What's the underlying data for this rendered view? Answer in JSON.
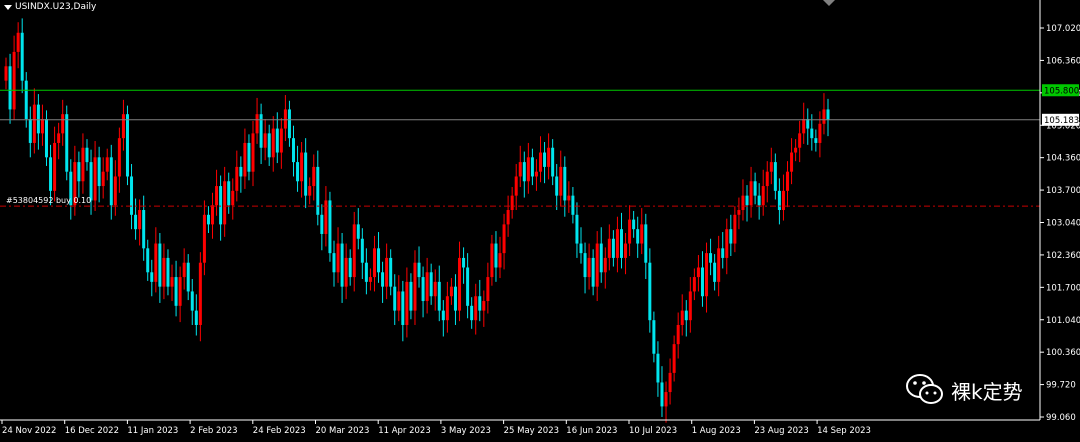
{
  "window": {
    "title": "USINDX.U23,Daily"
  },
  "order_label": "#53804592 buy 0.10",
  "watermark": {
    "text": "裸k定势",
    "icon": "wechat-icon"
  },
  "colors": {
    "background": "#000000",
    "bull": "#ff0000",
    "bear": "#00e5ee",
    "green_line": "#00c800",
    "price_line": "#808080",
    "order_line": "#c80000",
    "axis": "#ffffff",
    "green_tag": "#00c800"
  },
  "price_axis": {
    "ticks": [
      "107.020",
      "106.360",
      "105.680",
      "105.020",
      "104.360",
      "103.700",
      "103.040",
      "102.360",
      "101.700",
      "101.040",
      "100.360",
      "99.720",
      "99.060"
    ],
    "level_tags": {
      "green_level": "105.800",
      "current_price": "105.183"
    }
  },
  "time_axis": {
    "labels": [
      "24 Nov 2022",
      "16 Dec 2022",
      "11 Jan 2023",
      "2 Feb 2023",
      "24 Feb 2023",
      "20 Mar 2023",
      "11 Apr 2023",
      "3 May 2023",
      "25 May 2023",
      "16 Jun 2023",
      "10 Jul 2023",
      "1 Aug 2023",
      "23 Aug 2023",
      "14 Sep 2023"
    ]
  },
  "chart_data": {
    "type": "candlestick",
    "symbol": "USINDX.U23",
    "timeframe": "Daily",
    "ylim": [
      99.0,
      107.35
    ],
    "horizontal_levels": [
      {
        "label": "105.800",
        "price": 105.8
      },
      {
        "label": "105.183",
        "price": 105.183
      },
      {
        "label": "#53804592 buy 0.10",
        "price": 103.38
      }
    ],
    "closes": [
      106.3,
      105.4,
      106.6,
      107.0,
      106.0,
      105.2,
      104.7,
      105.5,
      104.9,
      105.2,
      104.4,
      103.7,
      104.7,
      104.9,
      105.3,
      104.1,
      103.4,
      104.3,
      103.9,
      104.6,
      104.3,
      103.5,
      104.4,
      103.8,
      104.1,
      104.4,
      103.4,
      104.0,
      104.8,
      105.3,
      104.0,
      103.2,
      102.9,
      103.3,
      102.5,
      102.0,
      101.8,
      102.6,
      101.7,
      102.3,
      101.7,
      101.9,
      101.3,
      101.9,
      102.2,
      101.6,
      101.2,
      100.9,
      102.2,
      103.2,
      103.0,
      103.4,
      103.8,
      103.0,
      103.9,
      103.4,
      103.7,
      104.2,
      104.0,
      104.7,
      104.1,
      104.9,
      105.3,
      104.6,
      104.9,
      104.4,
      105.0,
      104.5,
      105.0,
      105.4,
      104.8,
      104.3,
      103.9,
      104.5,
      103.6,
      103.8,
      104.2,
      103.2,
      102.8,
      103.5,
      102.4,
      102.0,
      102.6,
      101.7,
      102.3,
      101.9,
      103.0,
      102.7,
      102.2,
      101.8,
      101.9,
      102.5,
      102.0,
      101.7,
      102.3,
      101.7,
      101.2,
      101.6,
      100.9,
      101.8,
      101.2,
      102.2,
      101.9,
      101.4,
      102.0,
      101.5,
      101.8,
      101.2,
      101.0,
      101.5,
      101.7,
      101.2,
      102.3,
      102.1,
      101.3,
      101.0,
      101.5,
      101.2,
      101.4,
      101.9,
      102.6,
      102.1,
      102.4,
      103.0,
      103.3,
      103.6,
      104.0,
      104.3,
      103.9,
      104.4,
      104.0,
      104.1,
      104.5,
      104.2,
      104.6,
      104.0,
      103.6,
      104.2,
      103.5,
      103.6,
      103.2,
      102.6,
      102.4,
      101.9,
      102.3,
      101.7,
      102.6,
      102.0,
      102.3,
      102.7,
      102.3,
      102.9,
      102.3,
      102.6,
      103.1,
      102.9,
      102.6,
      103.0,
      102.2,
      101.0,
      100.3,
      99.7,
      99.2,
      99.5,
      99.9,
      100.5,
      100.9,
      101.2,
      101.0,
      101.6,
      101.9,
      102.1,
      101.5,
      102.4,
      102.2,
      101.8,
      102.5,
      102.3,
      102.9,
      102.6,
      103.2,
      103.3,
      103.6,
      103.4,
      103.9,
      103.6,
      103.4,
      103.8,
      104.1,
      104.3,
      103.7,
      103.3,
      103.7,
      104.1,
      104.5,
      104.6,
      104.9,
      105.2,
      105.0,
      104.8,
      104.7,
      105.1,
      105.4,
      105.183
    ]
  }
}
